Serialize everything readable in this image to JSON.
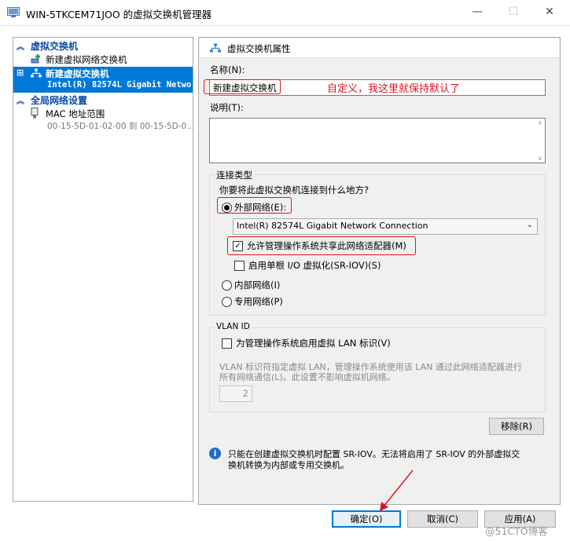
{
  "window": {
    "title": "WIN-5TKCEM71JOO 的虚拟交换机管理器",
    "minimize": "—",
    "maximize": "☐",
    "close": "✕"
  },
  "tree": {
    "section_switches": "虚拟交换机",
    "new_network_switch": "新建虚拟网络交换机",
    "selected_switch_name": "新建虚拟交换机",
    "selected_switch_adapter": "Intel(R) 82574L Gigabit Netwo...",
    "section_global": "全局网络设置",
    "mac_range_label": "MAC 地址范围",
    "mac_range_value": "00-15-5D-01-02-00 到 00-15-5D-0..."
  },
  "props": {
    "header": "虚拟交换机属性",
    "name_label": "名称(N):",
    "name_value": "新建虚拟交换机",
    "annotation": "自定义，我这里就保持默认了",
    "notes_label": "说明(T):",
    "notes_value": "",
    "connection_group": "连接类型",
    "connection_question": "你要将此虚拟交换机连接到什么地方?",
    "external_label": "外部网络(E):",
    "adapter_selected": "Intel(R) 82574L Gigabit Network Connection",
    "allow_mgmt_label": "允许管理操作系统共享此网络适配器(M)",
    "sriov_label": "启用单根 I/O 虚拟化(SR-IOV)(S)",
    "internal_label": "内部网络(I)",
    "private_label": "专用网络(P)",
    "vlan_group": "VLAN ID",
    "vlan_check_label": "为管理操作系统启用虚拟 LAN 标识(V)",
    "vlan_desc_line1": "VLAN 标识符指定虚拟 LAN，管理操作系统使用该 LAN 通过此网络适配器进行",
    "vlan_desc_line2": "所有网络通信(L)。此设置不影响虚拟机网络。",
    "vlan_value": "2",
    "remove_button": "移除(R)",
    "info_line1": "只能在创建虚拟交换机时配置 SR-IOV。无法将启用了 SR-IOV 的外部虚拟交",
    "info_line2": "换机转换为内部或专用交换机。"
  },
  "state": {
    "connection_type": "external",
    "allow_mgmt_checked": true,
    "sriov_checked": false,
    "vlan_checked": false
  },
  "buttons": {
    "ok": "确定(O)",
    "cancel": "取消(C)",
    "apply": "应用(A)"
  },
  "watermark": "@51CTO博客",
  "colors": {
    "selection": "#0078d7",
    "annotation_red": "#e0141e",
    "tree_heading": "#0a4aa6"
  }
}
